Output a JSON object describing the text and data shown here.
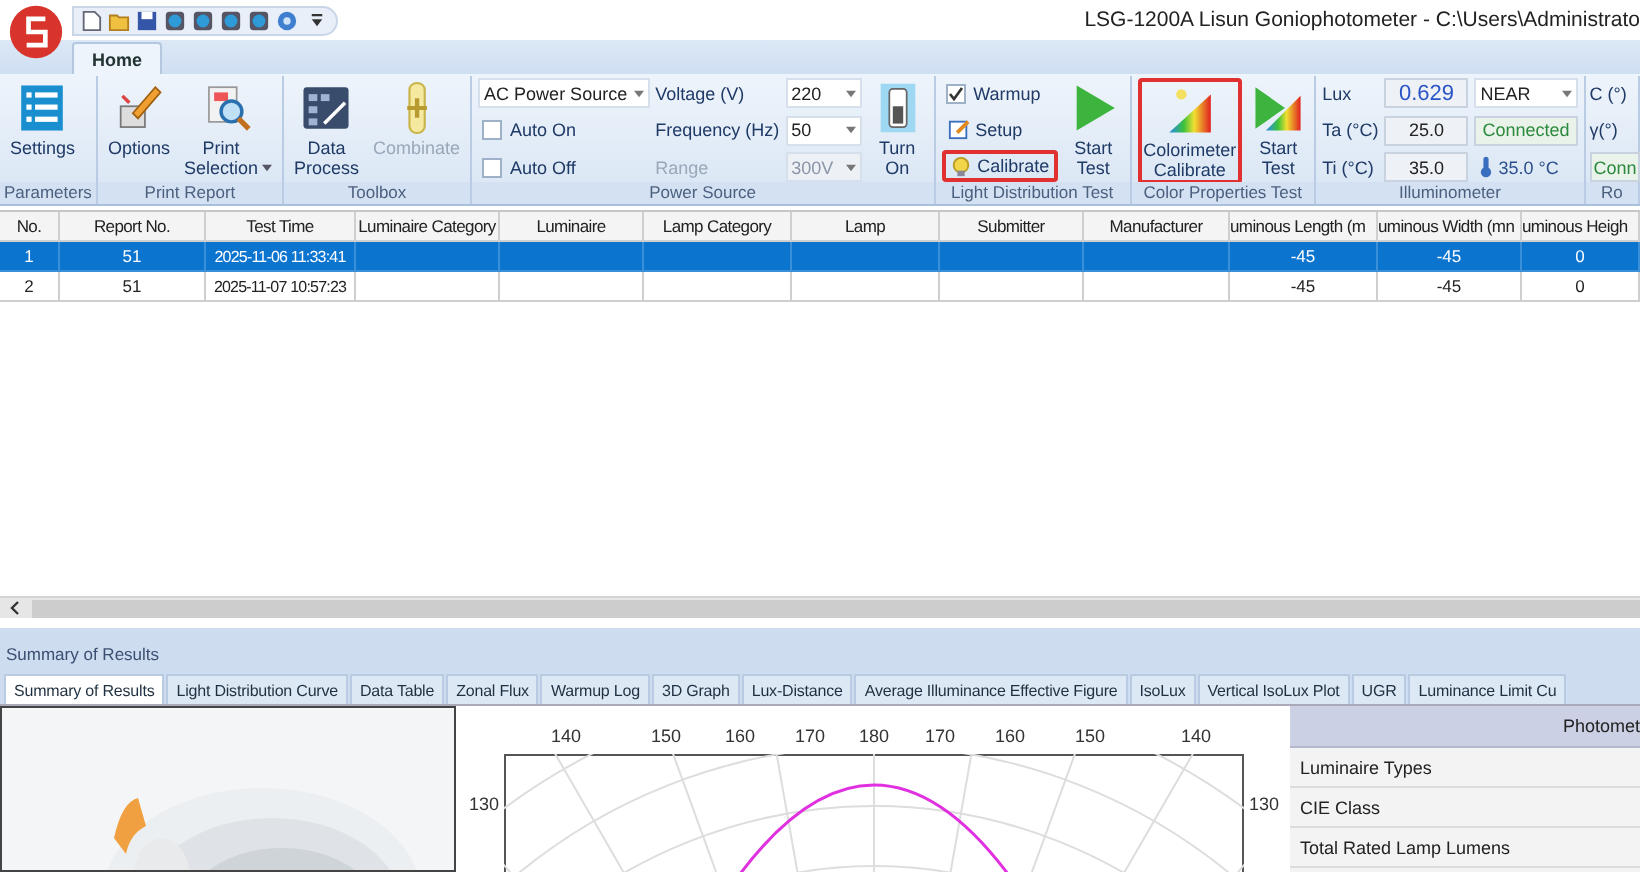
{
  "window": {
    "title": "LSG-1200A Lisun Goniophotometer  - C:\\Users\\Administrato"
  },
  "tabs": [
    {
      "label": "Home",
      "selected": true
    }
  ],
  "ribbon": [
    {
      "label": "Parameters",
      "columns": [
        [
          {
            "kind": "large",
            "label": "Settings",
            "disabled": false
          }
        ]
      ]
    },
    {
      "label": "Print Report",
      "columns": [
        [
          {
            "kind": "large",
            "label": "Options",
            "disabled": false
          }
        ],
        [
          {
            "kind": "large",
            "label": "Print\nSelection",
            "dropdown": true,
            "disabled": false
          }
        ]
      ]
    },
    {
      "label": "Toolbox",
      "columns": [
        [
          {
            "kind": "large",
            "label": "Data\nProcess",
            "disabled": false
          }
        ],
        [
          {
            "kind": "large",
            "label": "Combinate",
            "disabled": true
          }
        ]
      ]
    },
    {
      "label": "Power Source",
      "columns": [
        [
          {
            "kind": "combo",
            "value": "AC Power Source",
            "disabled": false
          },
          {
            "kind": "check",
            "label": "Auto On",
            "checked": false
          },
          {
            "kind": "check",
            "label": "Auto Off",
            "checked": false
          }
        ],
        [
          {
            "kind": "text",
            "label": "Voltage (V)",
            "disabled": false
          },
          {
            "kind": "text",
            "label": "Frequency (Hz)",
            "disabled": false
          },
          {
            "kind": "text",
            "label": "Range",
            "disabled": true
          }
        ],
        [
          {
            "kind": "combo",
            "value": "220",
            "disabled": false
          },
          {
            "kind": "combo",
            "value": "50",
            "disabled": false
          },
          {
            "kind": "combo",
            "value": "300V",
            "disabled": true
          }
        ],
        [
          {
            "kind": "large",
            "label": "Turn\nOn",
            "disabled": false
          }
        ]
      ]
    },
    {
      "label": "Light Distribution Test",
      "columns": [
        [
          {
            "kind": "check",
            "label": "Warmup",
            "checked": true
          },
          {
            "kind": "small",
            "label": "Setup",
            "highlighted": false
          },
          {
            "kind": "small",
            "label": "Calibrate",
            "highlighted": true
          }
        ],
        [
          {
            "kind": "large",
            "label": "Start\nTest",
            "disabled": false
          }
        ]
      ]
    },
    {
      "label": "Color Properties Test",
      "columns": [
        [
          {
            "kind": "large",
            "label": "Colorimeter\nCalibrate",
            "disabled": false,
            "highlighted": true
          }
        ],
        [
          {
            "kind": "large",
            "label": "Start\nTest",
            "disabled": false
          }
        ]
      ]
    },
    {
      "label": "Illuminometer",
      "columns": [
        [
          {
            "kind": "text",
            "label": "Lux",
            "disabled": false
          },
          {
            "kind": "text",
            "label": "Ta (°C)",
            "disabled": false
          },
          {
            "kind": "text",
            "label": "Ti (°C)",
            "disabled": false
          }
        ],
        [
          {
            "kind": "measure",
            "value": "0.629"
          },
          {
            "kind": "readout",
            "value": "25.0"
          },
          {
            "kind": "readout",
            "value": "35.0"
          }
        ],
        [
          {
            "kind": "combo",
            "value": "NEAR",
            "disabled": false
          },
          {
            "kind": "status",
            "value": "Connected"
          },
          {
            "kind": "temp",
            "value": "35.0 °C"
          }
        ]
      ]
    },
    {
      "label": "Ro",
      "columns": [
        [
          {
            "kind": "text",
            "label": "C (°)",
            "disabled": false
          },
          {
            "kind": "text",
            "label": "γ(°)",
            "disabled": false
          },
          {
            "kind": "status",
            "value": "Conn"
          }
        ]
      ]
    }
  ],
  "table": {
    "columns": [
      "No.",
      "Report No.",
      "Test Time",
      "Luminaire Category",
      "Luminaire",
      "Lamp Category",
      "Lamp",
      "Submitter",
      "Manufacturer",
      "uminous Length (m",
      "uminous Width (mn",
      "uminous Heigh"
    ],
    "rows": [
      {
        "selected": true,
        "cells": [
          "1",
          "51",
          "2025-11-06 11:33:41",
          null,
          null,
          null,
          null,
          null,
          null,
          "-45",
          "-45",
          "0"
        ]
      },
      {
        "selected": false,
        "cells": [
          "2",
          "51",
          "2025-11-07 10:57:23",
          null,
          null,
          null,
          null,
          null,
          null,
          "-45",
          "-45",
          "0"
        ]
      }
    ]
  },
  "results": {
    "title": "Summary of Results",
    "tabs": [
      {
        "label": "Summary of Results",
        "selected": true
      },
      {
        "label": "Light Distribution Curve",
        "selected": false
      },
      {
        "label": "Data Table",
        "selected": false
      },
      {
        "label": "Zonal Flux",
        "selected": false
      },
      {
        "label": "Warmup Log",
        "selected": false
      },
      {
        "label": "3D Graph",
        "selected": false
      },
      {
        "label": "Lux-Distance",
        "selected": false
      },
      {
        "label": "Average Illuminance Effective Figure",
        "selected": false
      },
      {
        "label": "IsoLux",
        "selected": false
      },
      {
        "label": "Vertical IsoLux Plot",
        "selected": false
      },
      {
        "label": "UGR",
        "selected": false
      },
      {
        "label": "Luminance Limit Cu",
        "selected": false
      }
    ],
    "polar": {
      "top_labels": [
        "140",
        "150",
        "160",
        "170",
        "180",
        "170",
        "160",
        "150",
        "140"
      ],
      "side_labels": [
        "130",
        "130"
      ]
    },
    "summary": {
      "header": "Photomet",
      "rows": [
        "Luminaire Types",
        "CIE Class",
        "Total Rated Lamp Lumens"
      ]
    }
  }
}
